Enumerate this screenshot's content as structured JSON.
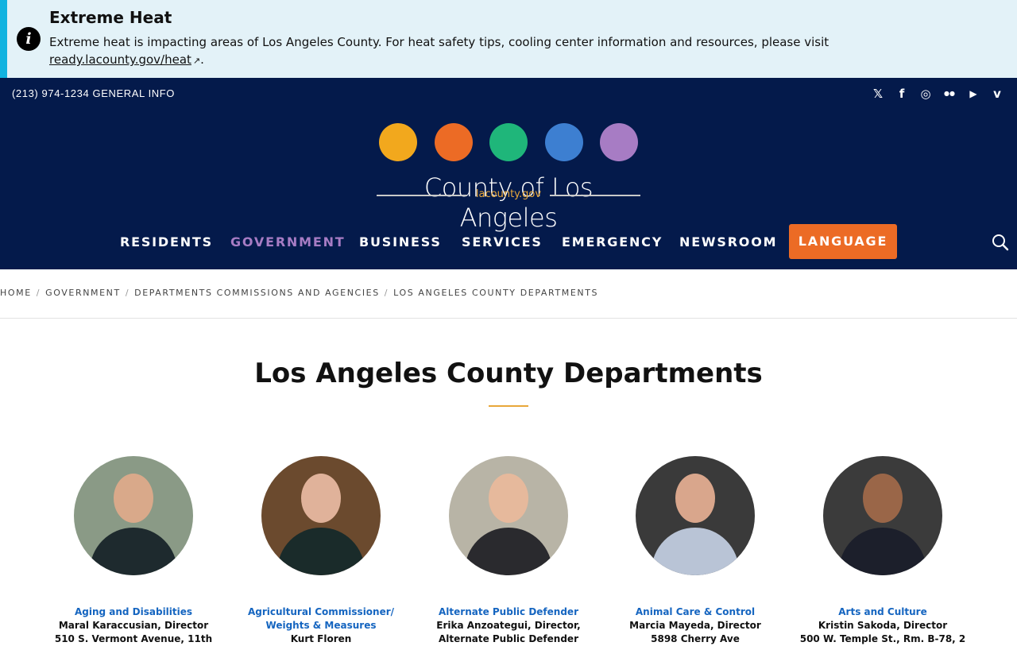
{
  "alert": {
    "title": "Extreme Heat",
    "text": "Extreme heat is impacting areas of Los Angeles County. For heat safety tips, cooling center information and resources, please visit ",
    "link": "ready.lacounty.gov/heat",
    "tail": ".",
    "info_icon": "i",
    "external_icon": "↗"
  },
  "topbar": {
    "phone": "(213) 974-1234 GENERAL INFO",
    "social": [
      "x-icon",
      "facebook-icon",
      "instagram-icon",
      "flickr-icon",
      "youtube-icon",
      "vimeo-icon"
    ],
    "social_glyphs": [
      "𝕏",
      "f",
      "◎",
      "●●",
      "▶",
      "v"
    ]
  },
  "logo": {
    "name": "County of Los Angeles",
    "sub": "lacounty.gov",
    "circle_colors": [
      "#f2a81d",
      "#ec6b25",
      "#1fb67a",
      "#3d7fd1",
      "#a77cc4"
    ]
  },
  "nav": {
    "items": [
      "RESIDENTS",
      "GOVERNMENT",
      "BUSINESS",
      "SERVICES",
      "EMERGENCY",
      "NEWSROOM"
    ],
    "active": "GOVERNMENT",
    "language": "LANGUAGE"
  },
  "breadcrumb": [
    "HOME",
    "GOVERNMENT",
    "DEPARTMENTS COMMISSIONS AND AGENCIES",
    "LOS ANGELES COUNTY DEPARTMENTS"
  ],
  "page": {
    "title": "Los Angeles County Departments"
  },
  "departments": [
    {
      "name": "Aging and Disabilities",
      "director": "Maral Karaccusian, Director",
      "extra": "510 S. Vermont Avenue, 11th"
    },
    {
      "name": "Agricultural Commissioner/ Weights & Measures",
      "director": "Kurt Floren",
      "extra": ""
    },
    {
      "name": "Alternate Public Defender",
      "director": "Erika Anzoategui, Director,",
      "extra": "Alternate Public Defender"
    },
    {
      "name": "Animal Care & Control",
      "director": "Marcia Mayeda, Director",
      "extra": "5898 Cherry Ave"
    },
    {
      "name": "Arts and Culture",
      "director": "Kristin Sakoda, Director",
      "extra": "500 W. Temple St., Rm. B-78, 2"
    }
  ],
  "colors": {
    "navy": "#041a4b",
    "orange": "#ec6b25",
    "purple": "#a77cc4",
    "link_blue": "#1565c0",
    "gold": "#e8a73a",
    "alert_bg": "#e3f2f8",
    "alert_border": "#12b3e0"
  }
}
